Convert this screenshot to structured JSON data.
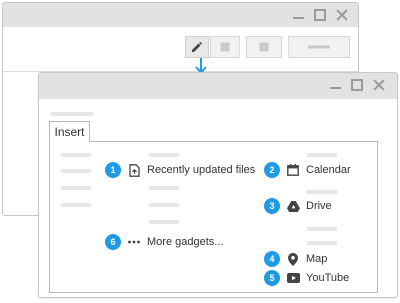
{
  "dialog": {
    "tab_label": "Insert"
  },
  "items": [
    {
      "num": "1",
      "label": "Recently updated files",
      "icon": "file-upload-icon"
    },
    {
      "num": "2",
      "label": "Calendar",
      "icon": "calendar-icon"
    },
    {
      "num": "3",
      "label": "Drive",
      "icon": "drive-icon"
    },
    {
      "num": "4",
      "label": "Map",
      "icon": "map-pin-icon"
    },
    {
      "num": "5",
      "label": "YouTube",
      "icon": "youtube-icon"
    },
    {
      "num": "6",
      "label": "More gadgets...",
      "icon": "more-icon"
    }
  ],
  "colors": {
    "accent": "#1e9be3",
    "titlebar": "#e2e2e2",
    "border": "#c8c8c8",
    "icon": "#444444"
  }
}
